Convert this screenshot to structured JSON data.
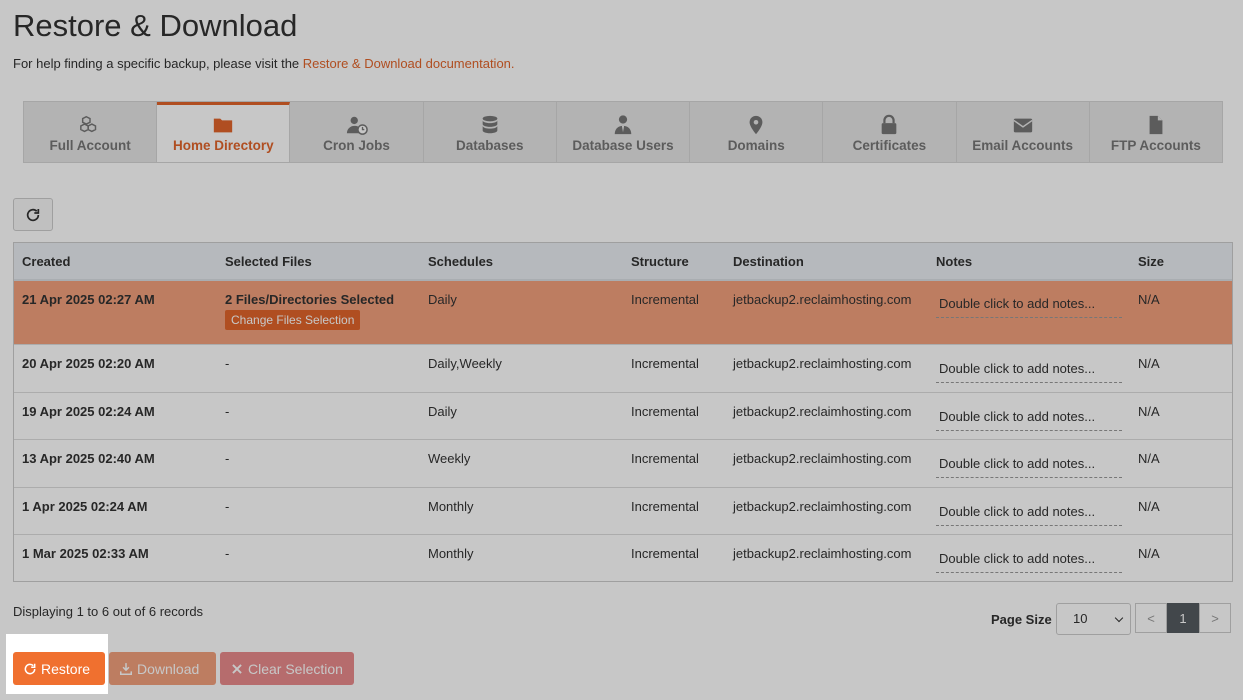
{
  "page": {
    "title": "Restore & Download",
    "help_prefix": "For help finding a specific backup, please visit the ",
    "help_link": "Restore & Download documentation."
  },
  "tabs": [
    {
      "label": "Full Account",
      "icon": "cubes-icon",
      "active": false
    },
    {
      "label": "Home Directory",
      "icon": "folder-icon",
      "active": true
    },
    {
      "label": "Cron Jobs",
      "icon": "user-clock-icon",
      "active": false
    },
    {
      "label": "Databases",
      "icon": "database-icon",
      "active": false
    },
    {
      "label": "Database Users",
      "icon": "user-tie-icon",
      "active": false
    },
    {
      "label": "Domains",
      "icon": "map-marker-icon",
      "active": false
    },
    {
      "label": "Certificates",
      "icon": "lock-icon",
      "active": false
    },
    {
      "label": "Email Accounts",
      "icon": "envelope-icon",
      "active": false
    },
    {
      "label": "FTP Accounts",
      "icon": "file-icon",
      "active": false
    }
  ],
  "table": {
    "headers": [
      "Created",
      "Selected Files",
      "Schedules",
      "Structure",
      "Destination",
      "Notes",
      "Size"
    ],
    "rows": [
      {
        "created": "21 Apr 2025 02:27 AM",
        "files": "2 Files/Directories Selected",
        "schedules": "Daily",
        "structure": "Incremental",
        "destination": "jetbackup2.reclaimhosting.com",
        "notes": "Double click to add notes...",
        "size": "N/A",
        "selected": true,
        "change_label": "Change Files Selection"
      },
      {
        "created": "20 Apr 2025 02:20 AM",
        "files": "-",
        "schedules": "Daily,Weekly",
        "structure": "Incremental",
        "destination": "jetbackup2.reclaimhosting.com",
        "notes": "Double click to add notes...",
        "size": "N/A"
      },
      {
        "created": "19 Apr 2025 02:24 AM",
        "files": "-",
        "schedules": "Daily",
        "structure": "Incremental",
        "destination": "jetbackup2.reclaimhosting.com",
        "notes": "Double click to add notes...",
        "size": "N/A"
      },
      {
        "created": "13 Apr 2025 02:40 AM",
        "files": "-",
        "schedules": "Weekly",
        "structure": "Incremental",
        "destination": "jetbackup2.reclaimhosting.com",
        "notes": "Double click to add notes...",
        "size": "N/A"
      },
      {
        "created": "1 Apr 2025 02:24 AM",
        "files": "-",
        "schedules": "Monthly",
        "structure": "Incremental",
        "destination": "jetbackup2.reclaimhosting.com",
        "notes": "Double click to add notes...",
        "size": "N/A"
      },
      {
        "created": "1 Mar 2025 02:33 AM",
        "files": "-",
        "schedules": "Monthly",
        "structure": "Incremental",
        "destination": "jetbackup2.reclaimhosting.com",
        "notes": "Double click to add notes...",
        "size": "N/A"
      }
    ]
  },
  "footer": {
    "display": "Displaying 1 to 6 out of 6 records",
    "page_size_label": "Page Size",
    "page_size_value": "10",
    "pager": {
      "prev": "<",
      "current": "1",
      "next": ">"
    }
  },
  "actions": {
    "restore": "Restore",
    "download": "Download",
    "clear": "Clear Selection"
  },
  "colors": {
    "accent": "#e2652b",
    "selected_row": "#f3a07d"
  }
}
